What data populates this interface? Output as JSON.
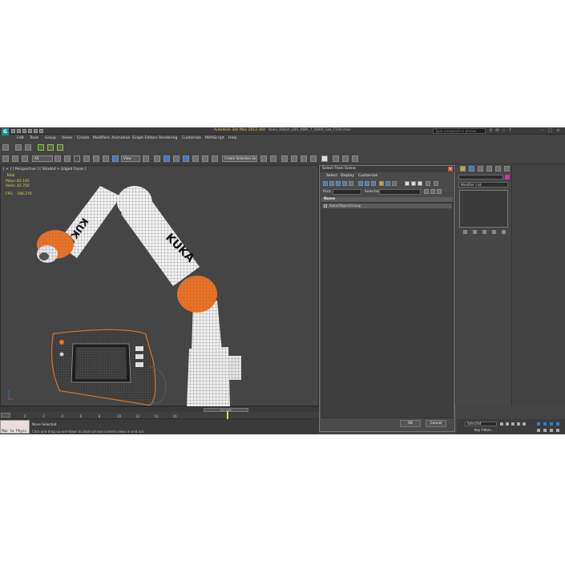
{
  "window": {
    "app_title": "Autodesk 3ds Max 2012 x64",
    "file_title": "Kuka_Robot_LBR_IIWA_7_R800_Set_T100.max",
    "search_placeholder": "Type a keyword or phrase"
  },
  "menu": [
    "Edit",
    "Tools",
    "Group",
    "Views",
    "Create",
    "Modifiers",
    "Animation",
    "Graph Editors",
    "Rendering",
    "Customize",
    "MAXScript",
    "Help"
  ],
  "toolbar": {
    "selection_filter": "All",
    "reference_coord": "View",
    "named_selection": "Create Selection Se"
  },
  "viewport": {
    "label": "[ + ] [ Perspective ] [ Shaded + Edged Faces ]",
    "stats": {
      "total_label": "Total",
      "polys_label": "Polys:",
      "polys_value": "83 195",
      "verts_label": "Verts:",
      "verts_value": "42 750",
      "fps_label": "FPS:",
      "fps_value": "196.270"
    }
  },
  "scene_dialog": {
    "title": "Select From Scene",
    "menu": [
      "Select",
      "Display",
      "Customize"
    ],
    "find_label": "Find:",
    "selection_set_label": "Selection Set:",
    "column_header": "Name",
    "items": [
      "Kuka/Object/Group"
    ],
    "ok_label": "OK",
    "cancel_label": "Cancel"
  },
  "command_panel": {
    "modifier_list": "Modifier List"
  },
  "timeline": {
    "slider_label": "0 / 100",
    "ticks": [
      "0",
      "2",
      "4",
      "6",
      "8",
      "10",
      "12",
      "14",
      "16"
    ],
    "current_frame": 11
  },
  "status": {
    "maxscript_text": "Max to Physc",
    "selection": "None Selected",
    "prompt": "Click and drag up-and-down to zoom all non-camera views in and out",
    "selected_dd": "Selected",
    "key_filters": "Key Filters..."
  },
  "colors": {
    "accent_orange": "#e8742a",
    "stats_yellow": "#e2d84c",
    "app_logo": "#1e8f8f"
  }
}
